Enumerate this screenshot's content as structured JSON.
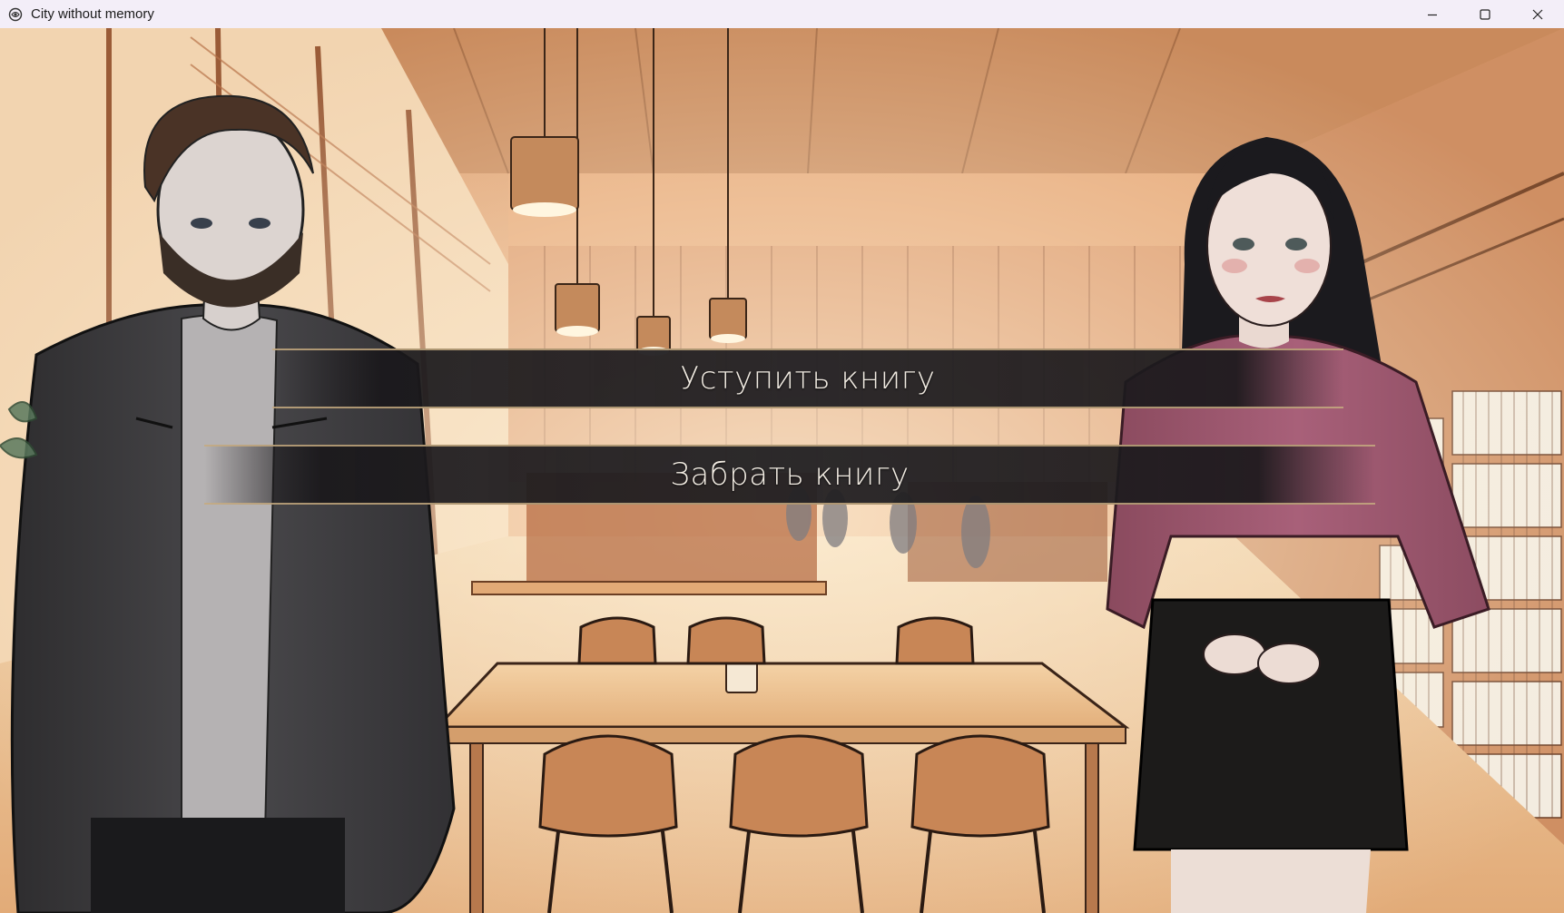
{
  "window": {
    "title": "City without memory",
    "controls": {
      "minimize": "minimize-icon",
      "maximize": "maximize-icon",
      "close": "close-icon"
    }
  },
  "scene": {
    "location": "library reading room",
    "characters": [
      "man-in-dark-jacket",
      "woman-in-pink-sweater"
    ]
  },
  "menu": {
    "choices": [
      {
        "label": "Уступить книгу"
      },
      {
        "label": "Забрать книгу"
      }
    ]
  },
  "colors": {
    "choice_text": "#f1ebe2",
    "choice_border": "#c6aa80",
    "choice_bg": "#222023",
    "scene_tint": "#e9b07a"
  }
}
